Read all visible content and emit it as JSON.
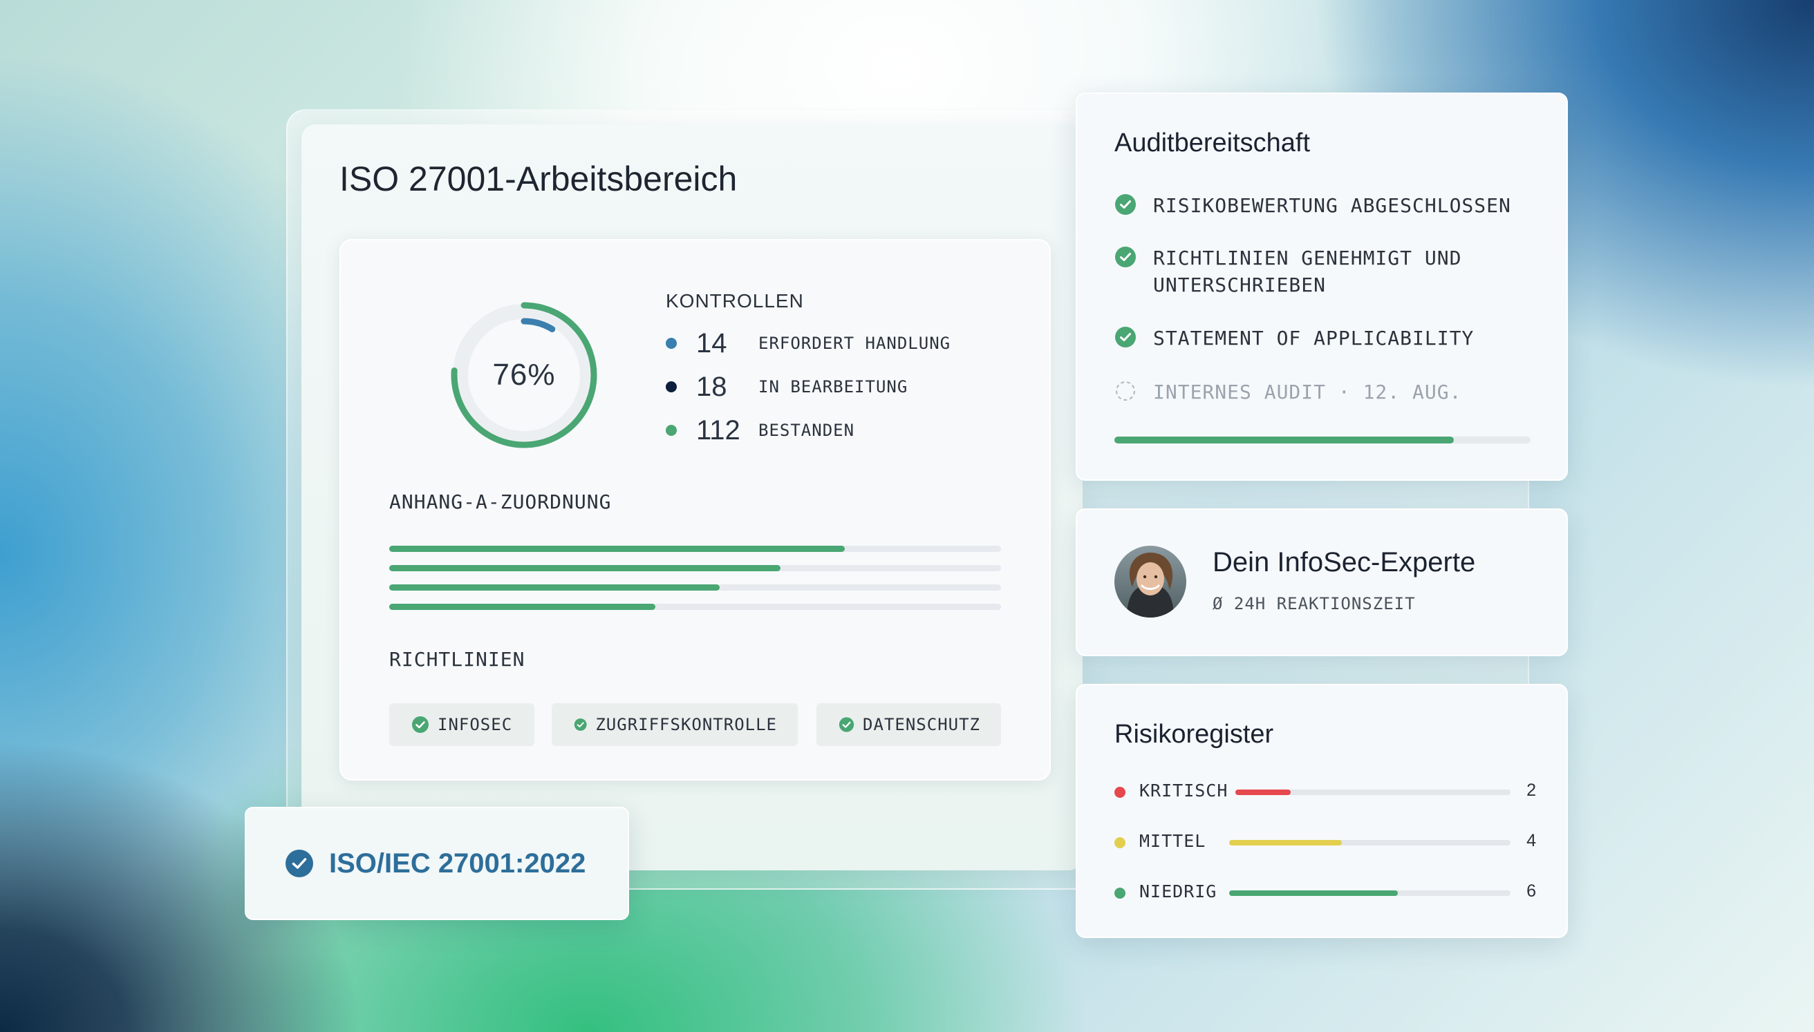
{
  "workspace": {
    "title": "ISO 27001-Arbeitsbereich",
    "progress_percent": 76,
    "progress_label": "76%",
    "kontrollen": {
      "heading": "KONTROLLEN",
      "items": [
        {
          "count": "14",
          "label": "ERFORDERT HANDLUNG",
          "color": "#3a7fae"
        },
        {
          "count": "18",
          "label": "IN BEARBEITUNG",
          "color": "#0f1e3d"
        },
        {
          "count": "112",
          "label": "BESTANDEN",
          "color": "#4aa673"
        }
      ]
    },
    "anhang": {
      "heading": "ANHANG-A-ZUORDNUNG",
      "bars": [
        0.745,
        0.64,
        0.54,
        0.435
      ]
    },
    "richtlinien": {
      "heading": "RICHTLINIEN",
      "chips": [
        "INFOSEC",
        "ZUGRIFFSKONTROLLE",
        "DATENSCHUTZ"
      ]
    }
  },
  "badge": {
    "label": "ISO/IEC 27001:2022"
  },
  "audit": {
    "title": "Auditbereitschaft",
    "items": [
      {
        "label": "RISIKOBEWERTUNG ABGESCHLOSSEN",
        "done": true
      },
      {
        "label": "RICHTLINIEN GENEHMIGT UND UNTERSCHRIEBEN",
        "done": true
      },
      {
        "label": "STATEMENT OF APPLICABILITY",
        "done": true
      },
      {
        "label": "INTERNES AUDIT · 12. AUG.",
        "done": false
      }
    ],
    "progress": 0.815
  },
  "expert": {
    "title": "Dein InfoSec-Experte",
    "subtitle": "Ø 24H REAKTIONSZEIT"
  },
  "risks": {
    "title": "Risikoregister",
    "max": 10,
    "items": [
      {
        "label": "KRITISCH",
        "count": "2",
        "value": 2,
        "color": "#e5484d"
      },
      {
        "label": "MITTEL",
        "count": "4",
        "value": 4,
        "color": "#e3cf4e"
      },
      {
        "label": "NIEDRIG",
        "count": "6",
        "value": 6,
        "color": "#4aa673"
      }
    ]
  },
  "colors": {
    "accent_green": "#4aa673",
    "accent_blue": "#3a7fae",
    "badge_blue": "#2d6e9a"
  }
}
